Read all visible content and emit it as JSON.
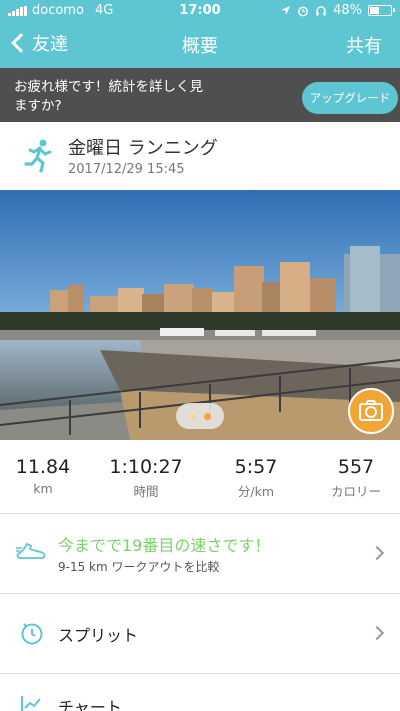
{
  "status_bar": {
    "carrier": "docomo",
    "network": "4G",
    "time": "17:00",
    "battery_text": "48%",
    "battery_level": 0.48,
    "icons": [
      "location-arrow-icon",
      "alarm-icon",
      "headphones-icon",
      "battery-icon"
    ]
  },
  "nav": {
    "back_label": "友達",
    "title": "概要",
    "share_label": "共有"
  },
  "banner": {
    "message": "お疲れ様です！統計を詳しく見ますか?",
    "upgrade_label": "アップグレード"
  },
  "activity": {
    "name": "金曜日 ランニング",
    "datetime": "2017/12/29 15:45",
    "icon": "runner-icon"
  },
  "photo": {
    "pager_count": 2,
    "active_page": 1
  },
  "stats": [
    {
      "value": "11.84",
      "unit": "km"
    },
    {
      "value": "1:10:27",
      "unit": "時間"
    },
    {
      "value": "5:57",
      "unit": "分/km"
    },
    {
      "value": "557",
      "unit": "カロリー"
    }
  ],
  "compare": {
    "title": "今までで19番目の速さです！",
    "subtitle": "9-15 km ワークアウトを比較"
  },
  "split": {
    "label": "スプリット"
  },
  "chart": {
    "label": "チャート"
  },
  "colors": {
    "accent": "#5ec5d3",
    "banner_bg": "#4f4f4f",
    "highlight_green": "#7ad36b",
    "camera_orange": "#f1a534"
  }
}
